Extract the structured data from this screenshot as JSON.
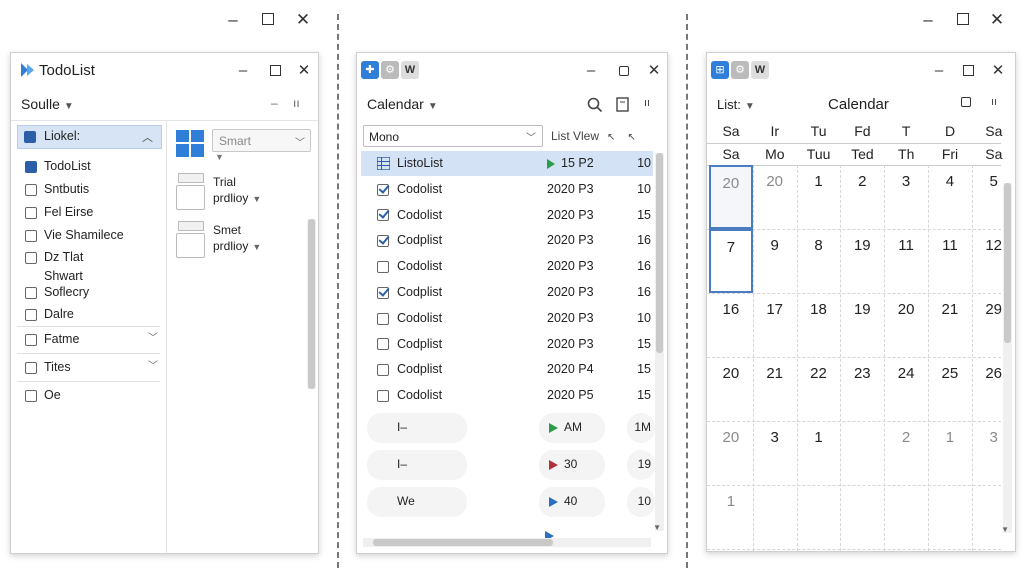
{
  "screen": {
    "top_controls": {
      "minimize": "–",
      "close": "✕"
    }
  },
  "todo_window": {
    "title": "TodoList",
    "toolbar": {
      "dropdown": "Soulle",
      "icons": [
        "–",
        "ıı"
      ]
    },
    "sidebar": {
      "header": "Liokel:",
      "items": [
        "TodoList",
        "Sntbutis",
        "Fel Eirse",
        "Vie Shamilece",
        "Dz Tlat",
        "Shwart",
        "Soflecry",
        "Dalre"
      ],
      "sections": [
        "Fatme",
        "Tites",
        "Oe"
      ]
    },
    "right_pane": {
      "dropdown": "Smart",
      "cards": [
        {
          "line1": "Trial",
          "line2": "prdlioy"
        },
        {
          "line1": "Smet",
          "line2": "prdlioy"
        }
      ]
    }
  },
  "list_window": {
    "title_icon": "W",
    "toolbar": {
      "dropdown": "Calendar",
      "icons": [
        "search-icon",
        "note-icon",
        "more-icon"
      ]
    },
    "filter": {
      "input": "Mono",
      "view": "List Vlew"
    },
    "rows": [
      {
        "name": "ListoList",
        "date": "15 P2",
        "num": "10",
        "state": "selected"
      },
      {
        "name": "Codolist",
        "date": "2020 P3",
        "num": "10",
        "state": "checked"
      },
      {
        "name": "Codolist",
        "date": "2020 P3",
        "num": "15",
        "state": "checked"
      },
      {
        "name": "Codplist",
        "date": "2020 P3",
        "num": "16",
        "state": "checked"
      },
      {
        "name": "Codolist",
        "date": "2020 P3",
        "num": "16",
        "state": "empty"
      },
      {
        "name": "Codplist",
        "date": "2020 P3",
        "num": "16",
        "state": "checked"
      },
      {
        "name": "Codolist",
        "date": "2020 P3",
        "num": "10",
        "state": "empty"
      },
      {
        "name": "Codplist",
        "date": "2020 P3",
        "num": "15",
        "state": "empty"
      },
      {
        "name": "Codplist",
        "date": "2020 P4",
        "num": "15",
        "state": "empty"
      },
      {
        "name": "Codolist",
        "date": "2020 P5",
        "num": "15",
        "state": "empty"
      }
    ],
    "extra_rows": [
      {
        "label": "I–",
        "value": "AM",
        "num": "1M",
        "color": "#2e9b48"
      },
      {
        "label": "I–",
        "value": "30",
        "num": "19",
        "color": "#b0303c"
      },
      {
        "label": "We",
        "value": "40",
        "num": "10",
        "color": "#2b6fc0"
      }
    ]
  },
  "calendar_window": {
    "title_icon": "W",
    "toolbar": {
      "dropdown": "List:",
      "title": "Calendar"
    },
    "header_row1": [
      "Sa",
      "Ir",
      "Tu",
      "Fd",
      "T",
      "D",
      "Sa"
    ],
    "header_row2": [
      "Sa",
      "Mo",
      "Tuu",
      "Ted",
      "Th",
      "Fri",
      "Sa"
    ],
    "weeks": [
      [
        "20",
        "20",
        "1",
        "2",
        "3",
        "4",
        "5"
      ],
      [
        "7",
        "9",
        "8",
        "19",
        "11",
        "11",
        "12"
      ],
      [
        "16",
        "17",
        "18",
        "19",
        "20",
        "21",
        "29"
      ],
      [
        "20",
        "21",
        "22",
        "23",
        "24",
        "25",
        "26"
      ],
      [
        "20",
        "3",
        "1",
        "",
        "2",
        "1",
        "3"
      ],
      [
        "1",
        "",
        "",
        "",
        "",
        "",
        ""
      ]
    ]
  }
}
